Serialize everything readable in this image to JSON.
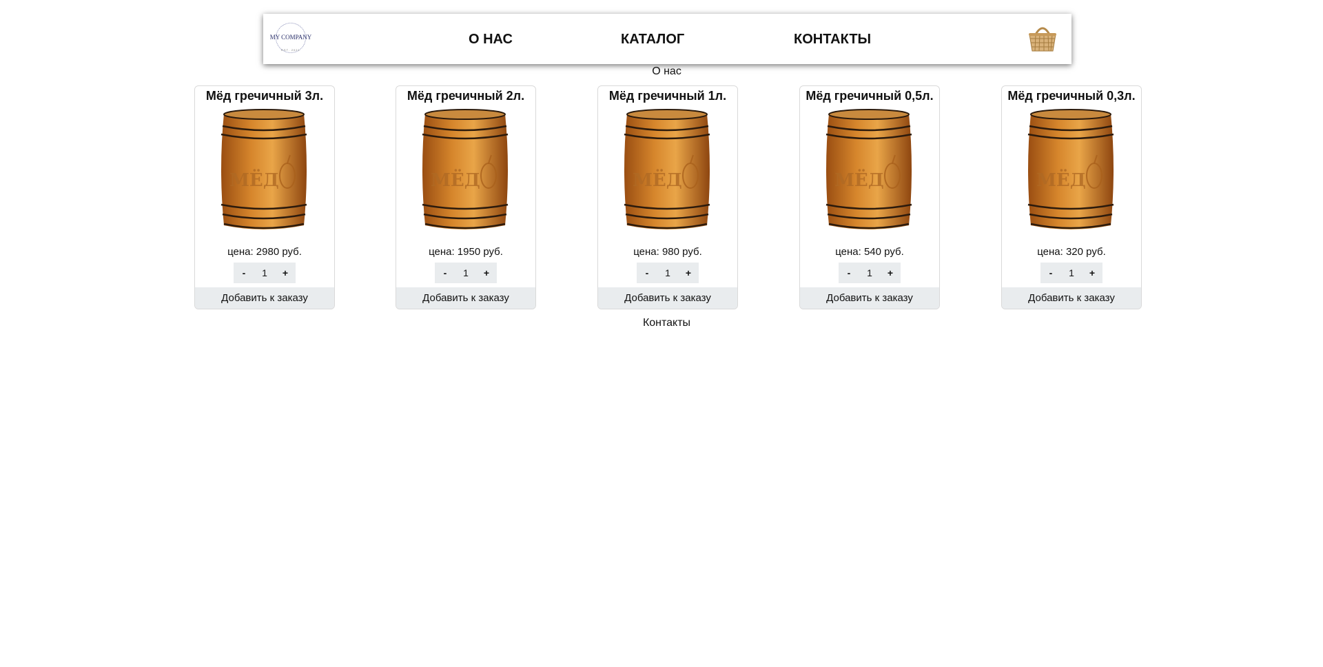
{
  "header": {
    "logo": {
      "name": "MY COMPANY",
      "subtitle": "EST. 2021"
    },
    "nav": [
      "О НАС",
      "КАТАЛОГ",
      "КОНТАКТЫ"
    ],
    "cart_icon": "basket-icon"
  },
  "sections": {
    "about": "О нас",
    "contacts": "Контакты"
  },
  "colors": {
    "wood": "#d6862c",
    "band": "#2b1a0c",
    "button_bg": "#e9ecee"
  },
  "products": [
    {
      "title": "Мёд гречичный 3л.",
      "price": "цена: 2980 руб.",
      "qty": "1",
      "minus": "-",
      "plus": "+",
      "add": "Добавить к заказу"
    },
    {
      "title": "Мёд гречичный 2л.",
      "price": "цена: 1950 руб.",
      "qty": "1",
      "minus": "-",
      "plus": "+",
      "add": "Добавить к заказу"
    },
    {
      "title": "Мёд гречичный 1л.",
      "price": "цена: 980 руб.",
      "qty": "1",
      "minus": "-",
      "plus": "+",
      "add": "Добавить к заказу"
    },
    {
      "title": "Мёд гречичный 0,5л.",
      "price": "цена: 540 руб.",
      "qty": "1",
      "minus": "-",
      "plus": "+",
      "add": "Добавить к заказу"
    },
    {
      "title": "Мёд гречичный 0,3л.",
      "price": "цена: 320 руб.",
      "qty": "1",
      "minus": "-",
      "plus": "+",
      "add": "Добавить к заказу"
    }
  ],
  "barrel_text": "МЁД"
}
